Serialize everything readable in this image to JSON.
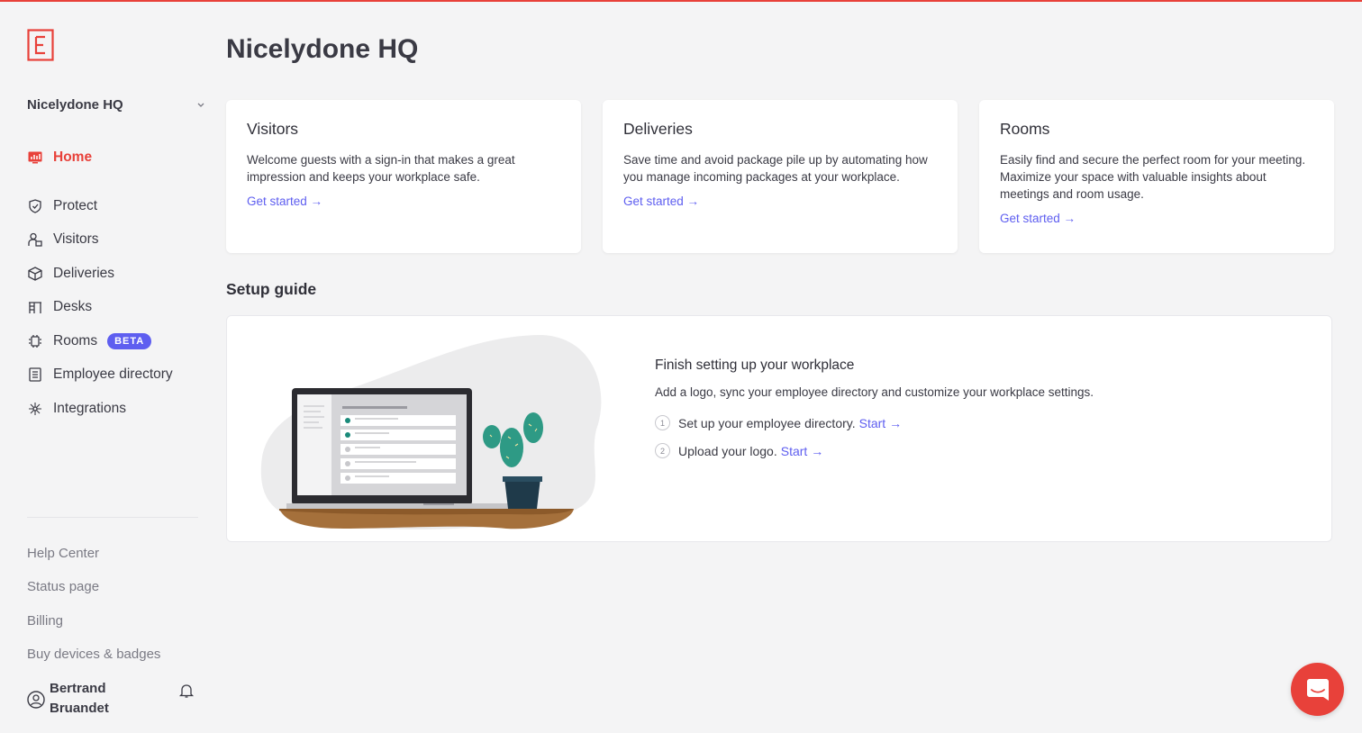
{
  "colors": {
    "accent": "#e8413a",
    "link": "#5e5ef0",
    "background": "#f4f4f5"
  },
  "sidebar": {
    "location": "Nicelydone HQ",
    "nav": [
      {
        "label": "Home",
        "icon": "home-chart-icon",
        "active": true
      },
      {
        "label": "Protect",
        "icon": "shield-icon"
      },
      {
        "label": "Visitors",
        "icon": "visitor-icon"
      },
      {
        "label": "Deliveries",
        "icon": "package-icon"
      },
      {
        "label": "Desks",
        "icon": "desk-icon"
      },
      {
        "label": "Rooms",
        "icon": "room-icon",
        "badge": "BETA"
      },
      {
        "label": "Employee directory",
        "icon": "directory-icon"
      },
      {
        "label": "Integrations",
        "icon": "integrations-icon"
      }
    ],
    "footer_links": [
      "Help Center",
      "Status page",
      "Billing",
      "Buy devices & badges"
    ],
    "user": {
      "name": "Bertrand Bruandet"
    }
  },
  "main": {
    "title": "Nicelydone HQ",
    "cards": [
      {
        "title": "Visitors",
        "description": "Welcome guests with a sign-in that makes a great impression and keeps your workplace safe.",
        "cta": "Get started →"
      },
      {
        "title": "Deliveries",
        "description": "Save time and avoid package pile up by automating how you manage incoming packages at your workplace.",
        "cta": "Get started →"
      },
      {
        "title": "Rooms",
        "description": "Easily find and secure the perfect room for your meeting. Maximize your space with valuable insights about meetings and room usage.",
        "cta": "Get started →"
      }
    ],
    "setup": {
      "section_title": "Setup guide",
      "title": "Finish setting up your workplace",
      "subtitle": "Add a logo, sync your employee directory and customize your workplace settings.",
      "steps": [
        {
          "num": "1",
          "text": "Set up your employee directory.",
          "cta": "Start →"
        },
        {
          "num": "2",
          "text": "Upload your logo.",
          "cta": "Start →"
        }
      ]
    }
  }
}
